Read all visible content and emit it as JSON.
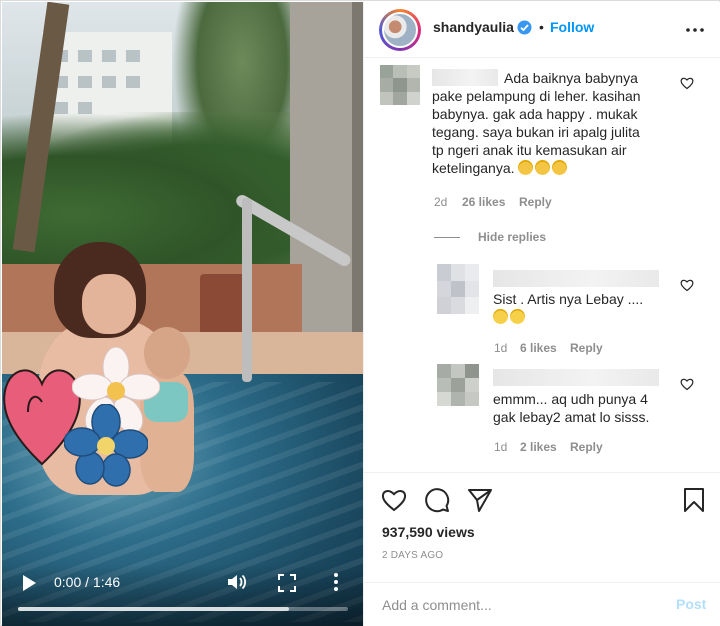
{
  "video": {
    "time": "0:00 / 1:46",
    "progress": 0.82
  },
  "header": {
    "username": "shandyaulia",
    "separator": "•",
    "follow_label": "Follow"
  },
  "comments": [
    {
      "text": "Ada baiknya babynya pake pelampung di leher. kasihan babynya. gak ada happy . mukak tegang. saya bukan iri apalg julita tp ngeri anak itu kemasukan air ketelinganya.",
      "age": "2d",
      "likes": "26 likes",
      "reply": "Reply"
    }
  ],
  "hide_replies": "Hide replies",
  "replies": [
    {
      "text": "Sist . Artis nya Lebay ....",
      "age": "1d",
      "likes": "6 likes",
      "reply": "Reply"
    },
    {
      "text_line1": "emmm... aq udh punya 4",
      "text_line2": "gak lebay2 amat lo sisss.",
      "age": "1d",
      "likes": "2 likes",
      "reply": "Reply"
    }
  ],
  "actions": {
    "views": "937,590 views",
    "date": "2 DAYS AGO"
  },
  "add_comment": {
    "placeholder": "Add a comment...",
    "post_label": "Post"
  },
  "colors": {
    "accent": "#0095f6",
    "post_disabled": "#b2dffc",
    "muted": "#8e8e8e"
  }
}
